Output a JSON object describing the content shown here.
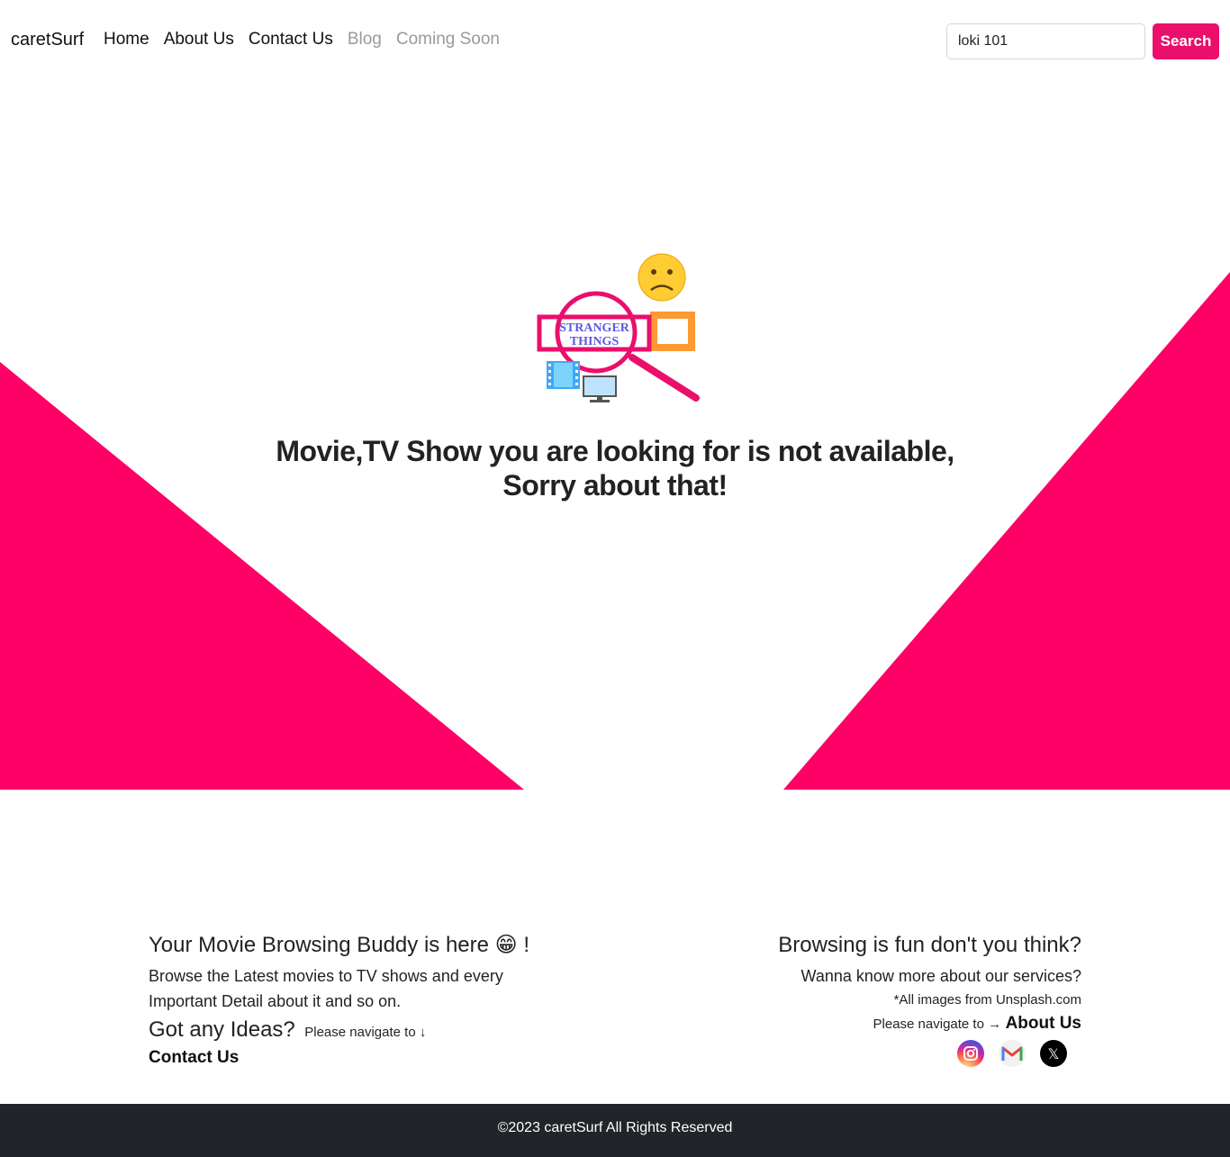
{
  "navbar": {
    "brand": "caretSurf",
    "links": [
      {
        "label": "Home"
      },
      {
        "label": "About Us"
      },
      {
        "label": "Contact Us"
      },
      {
        "label": "Blog"
      },
      {
        "label": "Coming Soon"
      }
    ],
    "search_value": "loki 101",
    "search_button": "Search"
  },
  "hero": {
    "message_line1": "Movie,TV Show you are looking for is not available,",
    "message_line2": "Sorry about that!",
    "accent_color": "#ff0066",
    "illustration_text": "STRANGER THINGS"
  },
  "footer": {
    "left_title": "Your Movie Browsing Buddy is here 😁 !",
    "left_text": "Browse the Latest movies to TV shows and every Important Detail about it and so on.",
    "ideas_title": "Got any Ideas?",
    "ideas_nav": "Please navigate to ↓",
    "contact_link": "Contact Us",
    "right_title": "Browsing is fun don't you think?",
    "right_text": "Wanna know more about our services?",
    "credit": "*All images from Unsplash.com",
    "about_nav": "Please navigate to →",
    "about_link": "About Us",
    "social_x_glyph": "𝕏"
  },
  "copyright": "©2023 caretSurf All Rights Reserved"
}
